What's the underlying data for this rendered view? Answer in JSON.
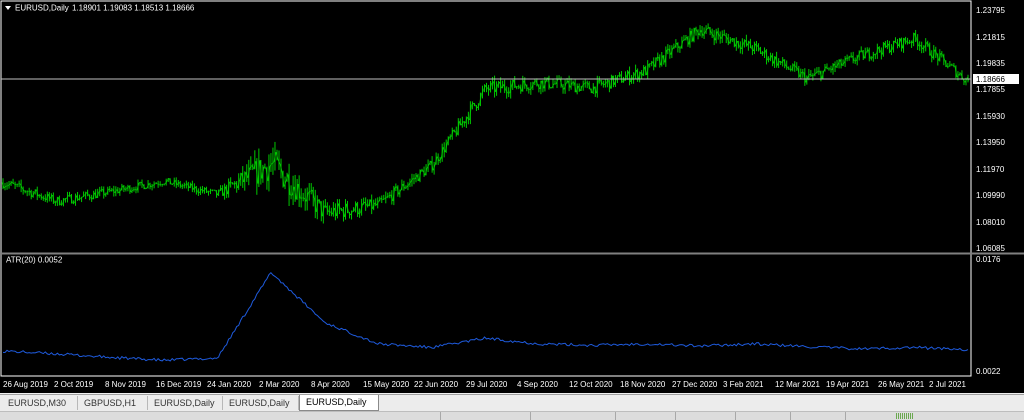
{
  "header": {
    "symbol_label": "EURUSD,Daily",
    "ohlc": "1.18901 1.19083 1.18513 1.18666",
    "menu_icon": "triangle-down-icon"
  },
  "price_axis": {
    "labels": [
      "1.23795",
      "1.21815",
      "1.19835",
      "1.17855",
      "1.15930",
      "1.13950",
      "1.11970",
      "1.09990",
      "1.08010",
      "1.06085"
    ],
    "current_price": "1.18666"
  },
  "indicator": {
    "label": "ATR(20) 0.0052",
    "axis_labels": [
      "0.0176",
      "0.0022"
    ]
  },
  "time_axis": {
    "labels": [
      "26 Aug 2019",
      "2 Oct 2019",
      "8 Nov 2019",
      "16 Dec 2019",
      "24 Jan 2020",
      "2 Mar 2020",
      "8 Apr 2020",
      "15 May 2020",
      "22 Jun 2020",
      "29 Jul 2020",
      "4 Sep 2020",
      "12 Oct 2020",
      "18 Nov 2020",
      "27 Dec 2020",
      "3 Feb 2021",
      "12 Mar 2021",
      "19 Apr 2021",
      "26 May 2021",
      "2 Jul 2021"
    ]
  },
  "tabs": [
    {
      "label": "EURUSD,M30",
      "active": false
    },
    {
      "label": "GBPUSD,H1",
      "active": false
    },
    {
      "label": "EURUSD,Daily",
      "active": false
    },
    {
      "label": "EURUSD,Daily",
      "active": false
    },
    {
      "label": "EURUSD,Daily",
      "active": true
    }
  ],
  "colors": {
    "background": "#000000",
    "candles": "#00c800",
    "atr_line": "#1e5adc",
    "price_line": "#c0c0c0",
    "text": "#ffffff"
  },
  "chart_data": {
    "type": "candlestick",
    "symbol": "EURUSD",
    "timeframe": "Daily",
    "x": [
      "26 Aug 2019",
      "2 Oct 2019",
      "8 Nov 2019",
      "16 Dec 2019",
      "24 Jan 2020",
      "2 Mar 2020",
      "8 Apr 2020",
      "15 May 2020",
      "22 Jun 2020",
      "29 Jul 2020",
      "4 Sep 2020",
      "12 Oct 2020",
      "18 Nov 2020",
      "27 Dec 2020",
      "3 Feb 2021",
      "12 Mar 2021",
      "19 Apr 2021",
      "26 May 2021",
      "2 Jul 2021"
    ],
    "close": [
      1.11,
      1.096,
      1.103,
      1.111,
      1.101,
      1.124,
      1.087,
      1.093,
      1.123,
      1.18,
      1.185,
      1.181,
      1.194,
      1.225,
      1.211,
      1.188,
      1.205,
      1.218,
      1.186
    ],
    "last_ohlc": {
      "open": 1.18901,
      "high": 1.19083,
      "low": 1.18513,
      "close": 1.18666
    },
    "ylim": [
      1.06085,
      1.23795
    ],
    "indicator": {
      "name": "ATR(20)",
      "current": 0.0052,
      "ylim": [
        0.0022,
        0.0176
      ],
      "values": [
        0.005,
        0.0046,
        0.0041,
        0.0037,
        0.004,
        0.016,
        0.009,
        0.006,
        0.0055,
        0.0068,
        0.006,
        0.0058,
        0.006,
        0.0057,
        0.006,
        0.0056,
        0.0053,
        0.0055,
        0.0052
      ]
    }
  }
}
